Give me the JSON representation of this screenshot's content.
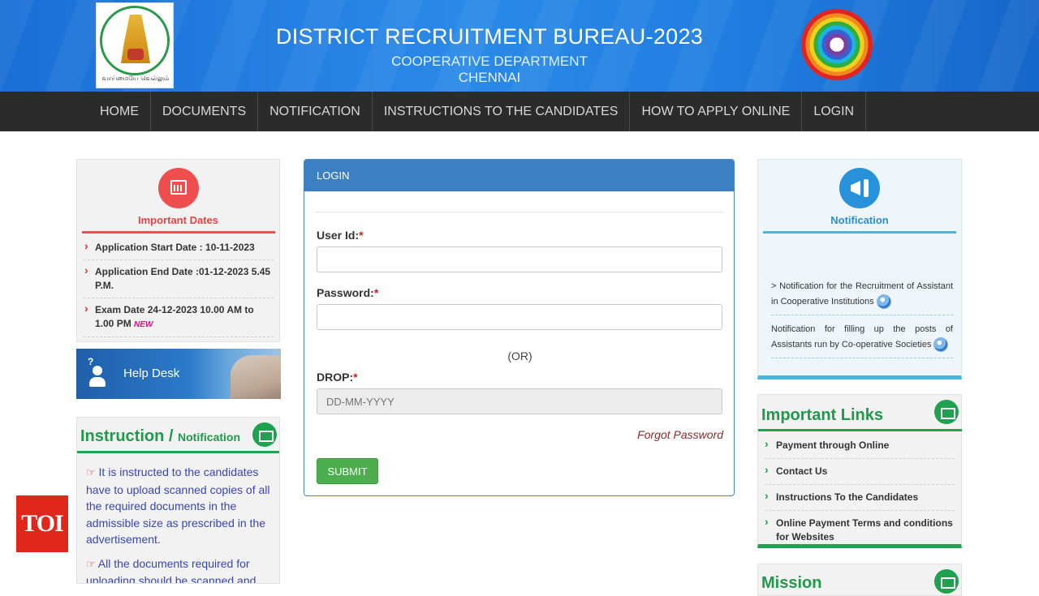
{
  "header": {
    "title": "DISTRICT RECRUITMENT BUREAU-2023",
    "subtitle1": "COOPERATIVE DEPARTMENT",
    "subtitle2": "CHENNAI",
    "emblem_text": "வாய்மையே வெல்லும்"
  },
  "nav": {
    "items": [
      {
        "label": "HOME"
      },
      {
        "label": "DOCUMENTS"
      },
      {
        "label": "NOTIFICATION"
      },
      {
        "label": "INSTRUCTIONS TO THE CANDIDATES"
      },
      {
        "label": "HOW TO APPLY ONLINE"
      },
      {
        "label": "LOGIN"
      }
    ]
  },
  "important_dates": {
    "title": "Important Dates",
    "items": [
      {
        "text": "Application Start Date : 10-11-2023"
      },
      {
        "text": "Application End Date :01-12-2023 5.45 P.M."
      },
      {
        "text": "Exam Date 24-12-2023 10.00 AM to 1.00 PM",
        "badge": "NEW"
      }
    ]
  },
  "helpdesk": {
    "label": "Help Desk"
  },
  "instruction": {
    "title_main": "Instruction /",
    "title_small": "Notification",
    "paragraphs": [
      "It is instructed to the candidates have to upload scanned copies of all the required documents in the admissible size as prescribed in the advertisement.",
      "All the documents required for uploading should be scanned and"
    ]
  },
  "login": {
    "header": "LOGIN",
    "user_label": "User Id:",
    "user_value": "",
    "password_label": "Password:",
    "password_value": "",
    "required_mark": "*",
    "or_text": "(OR)",
    "drop_label": "DROP:",
    "drop_placeholder": "DD-MM-YYYY",
    "forgot": "Forgot Password",
    "submit": "SUBMIT"
  },
  "notification": {
    "title": "Notification",
    "items": [
      {
        "text": "> Notification for the Recruitment of Assistant in Cooperative Institutions"
      },
      {
        "text": "Notification for filling up the posts of Assistants run by Co-operative Societies"
      }
    ]
  },
  "important_links": {
    "title": "Important Links",
    "items": [
      {
        "label": "Payment through Online"
      },
      {
        "label": "Contact Us"
      },
      {
        "label": "Instructions To the Candidates"
      },
      {
        "label": "Online Payment Terms and conditions for Websites"
      }
    ]
  },
  "mission": {
    "title": "Mission"
  },
  "watermark": {
    "label": "TOI"
  },
  "colors": {
    "header_blue": "#1f7ee0",
    "nav_bg": "#2b2b2b",
    "accent_red": "#ef4e4e",
    "accent_green": "#1fa14f",
    "login_blue": "#3c7fc2",
    "submit_green": "#4cae4c"
  }
}
